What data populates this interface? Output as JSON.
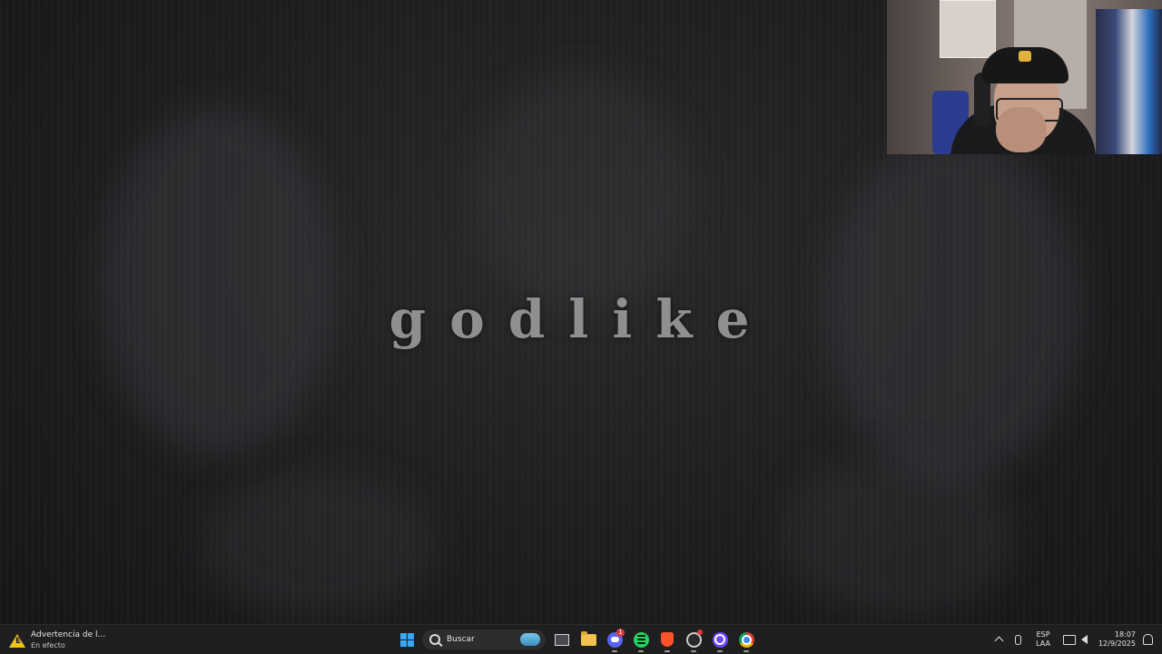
{
  "desktop": {
    "title": "godlike"
  },
  "taskbar": {
    "notification": {
      "title": "Advertencia de l...",
      "subtitle": "En efecto",
      "icon": "warning-icon",
      "badge_text": "ECO"
    },
    "search": {
      "label": "Buscar"
    },
    "apps": [
      {
        "name": "windows-start",
        "icon": "windows-logo-icon"
      },
      {
        "name": "search",
        "icon": "search-icon"
      },
      {
        "name": "task-view",
        "icon": "task-view-icon"
      },
      {
        "name": "file-explorer",
        "icon": "folder-icon"
      },
      {
        "name": "discord",
        "icon": "discord-icon",
        "badge": "1"
      },
      {
        "name": "spotify",
        "icon": "spotify-icon"
      },
      {
        "name": "brave",
        "icon": "brave-icon"
      },
      {
        "name": "obs",
        "icon": "obs-icon"
      },
      {
        "name": "proton",
        "icon": "proton-icon"
      },
      {
        "name": "chrome",
        "icon": "chrome-icon"
      }
    ],
    "tray": {
      "lang_top": "ESP",
      "lang_bottom": "LAA",
      "time": "18:07",
      "date": "12/9/2025"
    }
  },
  "colors": {
    "wallpaper": "#1e1e20",
    "title_text": "#8f8f92",
    "taskbar": "#1f1f21",
    "accent_blue": "#3aa7f2"
  }
}
